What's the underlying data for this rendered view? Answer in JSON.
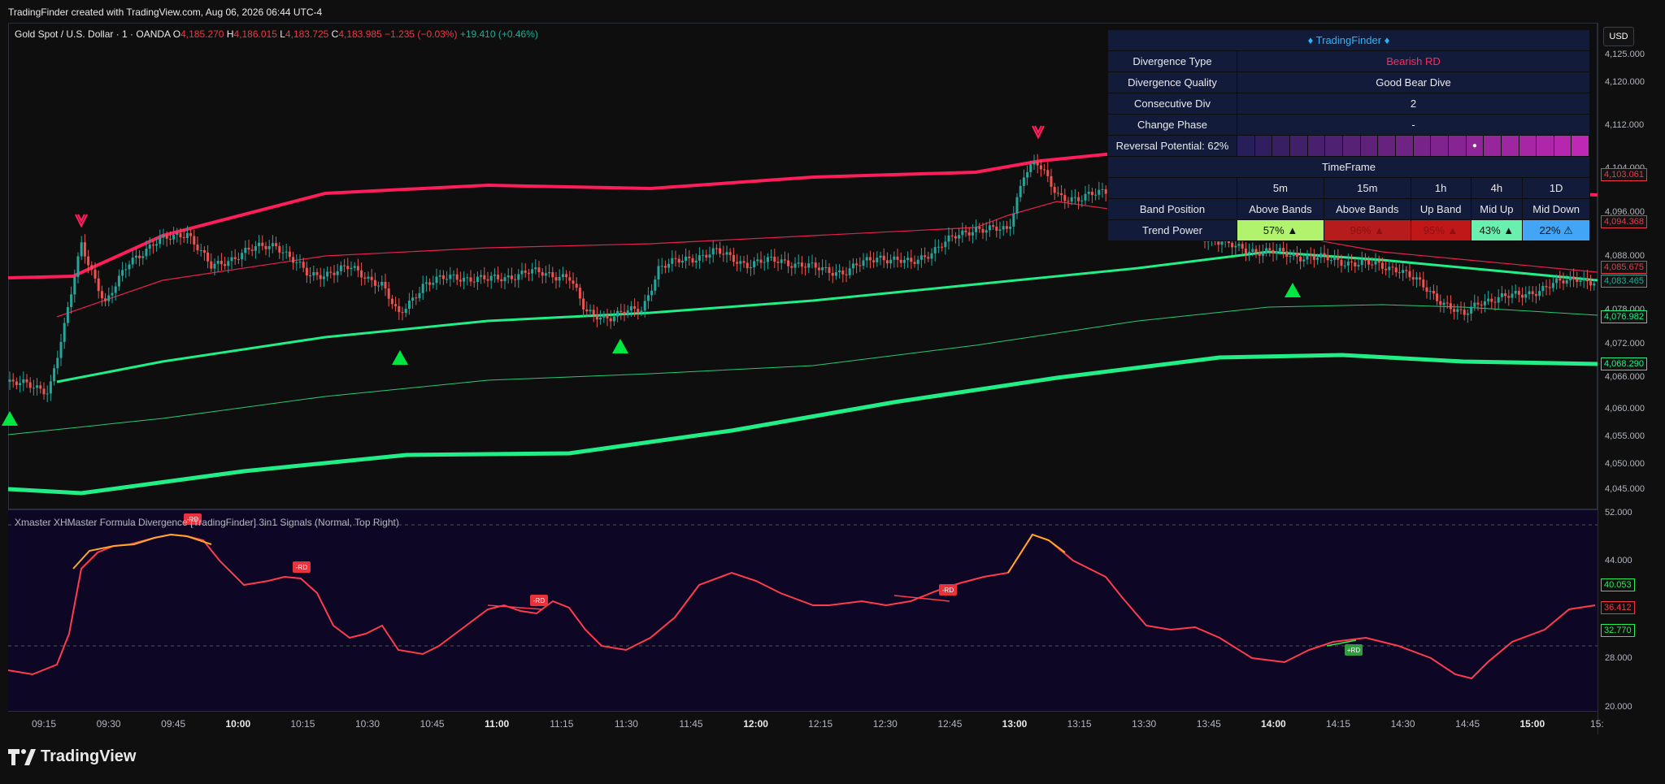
{
  "header": {
    "caption": "TradingFinder created with TradingView.com, Aug 06, 2026 06:44 UTC-4"
  },
  "legend": {
    "symbol": "Gold Spot / U.S. Dollar · 1 · OANDA",
    "open_label": "O",
    "open": "4,185.270",
    "high_label": "H",
    "high": "4,186.015",
    "low_label": "L",
    "low": "4,183.725",
    "close_label": "C",
    "close": "4,183.985",
    "change": "−1.235 (−0.03%)",
    "change_alt": "+19.410 (+0.46%)"
  },
  "currency": "USD",
  "price_axis": {
    "ticks": [
      "4,125.000",
      "4,120.000",
      "4,112.000",
      "4,104.000",
      "4,096.000",
      "4,088.000",
      "4,078.000",
      "4,072.000",
      "4,066.000",
      "4,060.000",
      "4,055.000",
      "4,050.000",
      "4,045.000"
    ],
    "tags": [
      {
        "value": "4,103.061",
        "color": "#f23645",
        "bg": "#131313"
      },
      {
        "value": "4,094.368",
        "color": "#f23645",
        "bg": "#131313"
      },
      {
        "value": "4,085.675",
        "color": "#f23645",
        "bg": "#131313"
      },
      {
        "value": "4,083.465",
        "color": "#22ab94",
        "bg": "#131313"
      },
      {
        "value": "4,076.982",
        "color": "#22ee88",
        "bg": "#131313"
      },
      {
        "value": "4,068.290",
        "color": "#22ee88",
        "bg": "#131313"
      }
    ]
  },
  "osc_axis": {
    "ticks": [
      "52.000",
      "44.000",
      "28.000",
      "20.000"
    ],
    "tags": [
      {
        "value": "40.053",
        "color": "#22ee55"
      },
      {
        "value": "36.412",
        "color": "#f23645"
      },
      {
        "value": "32.770",
        "color": "#22ee55"
      }
    ]
  },
  "time_axis": {
    "labels": [
      {
        "t": "09:15",
        "bold": false
      },
      {
        "t": "09:30",
        "bold": false
      },
      {
        "t": "09:45",
        "bold": false
      },
      {
        "t": "10:00",
        "bold": true
      },
      {
        "t": "10:15",
        "bold": false
      },
      {
        "t": "10:30",
        "bold": false
      },
      {
        "t": "10:45",
        "bold": false
      },
      {
        "t": "11:00",
        "bold": true
      },
      {
        "t": "11:15",
        "bold": false
      },
      {
        "t": "11:30",
        "bold": false
      },
      {
        "t": "11:45",
        "bold": false
      },
      {
        "t": "12:00",
        "bold": true
      },
      {
        "t": "12:15",
        "bold": false
      },
      {
        "t": "12:30",
        "bold": false
      },
      {
        "t": "12:45",
        "bold": false
      },
      {
        "t": "13:00",
        "bold": true
      },
      {
        "t": "13:15",
        "bold": false
      },
      {
        "t": "13:30",
        "bold": false
      },
      {
        "t": "13:45",
        "bold": false
      },
      {
        "t": "14:00",
        "bold": true
      },
      {
        "t": "14:15",
        "bold": false
      },
      {
        "t": "14:30",
        "bold": false
      },
      {
        "t": "14:45",
        "bold": false
      },
      {
        "t": "15:00",
        "bold": true
      },
      {
        "t": "15:",
        "bold": false
      }
    ]
  },
  "oscillator": {
    "legend": "Xmaster XHMaster Formula Divergence [TradingFinder] 3in1 Signals (Normal, Top Right)",
    "signal_rd": "-RD",
    "signal_pos": "+RD"
  },
  "table": {
    "title": "♦ TradingFinder ♦",
    "rows": [
      {
        "label": "Divergence Type",
        "value": "Bearish RD"
      },
      {
        "label": "Divergence Quality",
        "value": "Good Bear Dive"
      },
      {
        "label": "Consecutive Div",
        "value": "2"
      },
      {
        "label": "Change Phase",
        "value": "-"
      }
    ],
    "reversal_label": "Reversal Potential: 62%",
    "reversal_marker": "●",
    "timeframe_label": "TimeFrame",
    "timeframes": [
      "5m",
      "15m",
      "1h",
      "4h",
      "1D"
    ],
    "band_label": "Band Position",
    "band_values": [
      "Above Bands",
      "Above Bands",
      "Up Band",
      "Mid Up",
      "Mid Down"
    ],
    "trend_label": "Trend Power",
    "trend_values": [
      {
        "text": "57% ▲",
        "bg": "#b2f36e",
        "fg": "#111111"
      },
      {
        "text": "96% ▲",
        "bg": "#b71c1c",
        "fg": "#8b1010"
      },
      {
        "text": "95% ▲",
        "bg": "#c01818",
        "fg": "#8b1010"
      },
      {
        "text": "43% ▲",
        "bg": "#69f0ae",
        "fg": "#111111"
      },
      {
        "text": "22% ⚠",
        "bg": "#42a5f5",
        "fg": "#111111"
      }
    ]
  },
  "brand": {
    "name": "TradingView"
  },
  "colors": {
    "bear": "#ff1e5a",
    "bull": "#22ee88",
    "candle_up": "#26a69a",
    "candle_down": "#ef5350"
  }
}
